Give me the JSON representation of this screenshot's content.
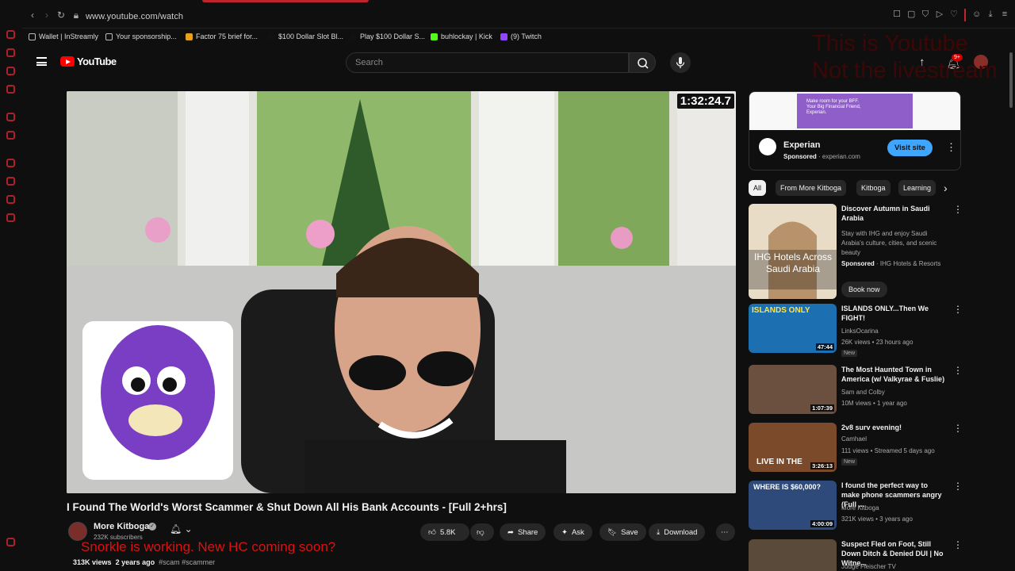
{
  "browser": {
    "url": "www.youtube.com/watch",
    "bookmarks": [
      "Wallet | InStreamly",
      "Your sponsorship...",
      "Factor 75 brief for...",
      "$100 Dollar Slot Bl...",
      "Play $100 Dollar S...",
      "buhlockay | Kick",
      "(9) Twitch"
    ]
  },
  "header": {
    "logo_text": "YouTube",
    "search_placeholder": "Search",
    "notification_count": "9+",
    "overlay_text_1": "This is Youtube",
    "overlay_text_2": "Not the livestream"
  },
  "video": {
    "timer": "1:32:24.7",
    "title": "I Found The World's Worst Scammer & Shut Down All His Bank Accounts - [Full 2+hrs]",
    "channel": "More Kitboga",
    "subscribers": "232K subscribers",
    "overlay_text": "Snorkle is working. New HC coming soon?",
    "views": "313K views",
    "age": "2 years ago",
    "tags": "#scam #scammer",
    "like_count": "5.8K",
    "share_label": "Share",
    "ask_label": "Ask",
    "save_label": "Save",
    "download_label": "Download"
  },
  "ad": {
    "image_text": "Make room for your BFF. Your Big Financial Friend, Experian.",
    "name": "Experian",
    "sponsored": "Sponsored",
    "domain": "experian.com",
    "cta": "Visit site"
  },
  "chips": [
    "All",
    "From More Kitboga",
    "Kitboga",
    "Learning"
  ],
  "sidebar": {
    "sponsored_item": {
      "thumb_text": "IHG Hotels Across Saudi Arabia",
      "title": "Discover Autumn in Saudi Arabia",
      "desc": "Stay with IHG and enjoy Saudi Arabia's culture, cities, and scenic beauty",
      "sponsored": "Sponsored",
      "advertiser": "IHG Hotels & Resorts",
      "cta": "Book now"
    },
    "items": [
      {
        "title": "ISLANDS ONLY...Then We FIGHT!",
        "channel": "LinksOcarina",
        "stats": "26K views • 23 hours ago",
        "badge": "New",
        "duration": "47:44",
        "thumb_text": "ISLANDS ONLY",
        "color": "#1c6fb0"
      },
      {
        "title": "The Most Haunted Town in America (w/ Valkyrae & Fuslie)",
        "channel": "Sam and Colby",
        "stats": "10M views • 1 year ago",
        "badge": "",
        "duration": "1:07:39",
        "thumb_text": "",
        "color": "#6b5040"
      },
      {
        "title": "2v8 surv evening!",
        "channel": "Camhael",
        "stats": "111 views • Streamed 5 days ago",
        "badge": "New",
        "duration": "3:26:13",
        "thumb_text": "LIVE IN THE",
        "color": "#7a4a2a"
      },
      {
        "title": "I found the perfect way to make phone scammers angry (Full ...",
        "channel": "More Kitboga",
        "stats": "321K views • 3 years ago",
        "badge": "",
        "duration": "4:00:09",
        "thumb_text": "WHERE IS $60,000?",
        "color": "#2d4a7a"
      },
      {
        "title": "Suspect Fled on Foot, Still Down Ditch & Denied DUI | No Witne...",
        "channel": "Judge Fleischer TV",
        "stats": "",
        "badge": "",
        "duration": "",
        "thumb_text": "",
        "color": "#5a4a3a"
      }
    ]
  }
}
